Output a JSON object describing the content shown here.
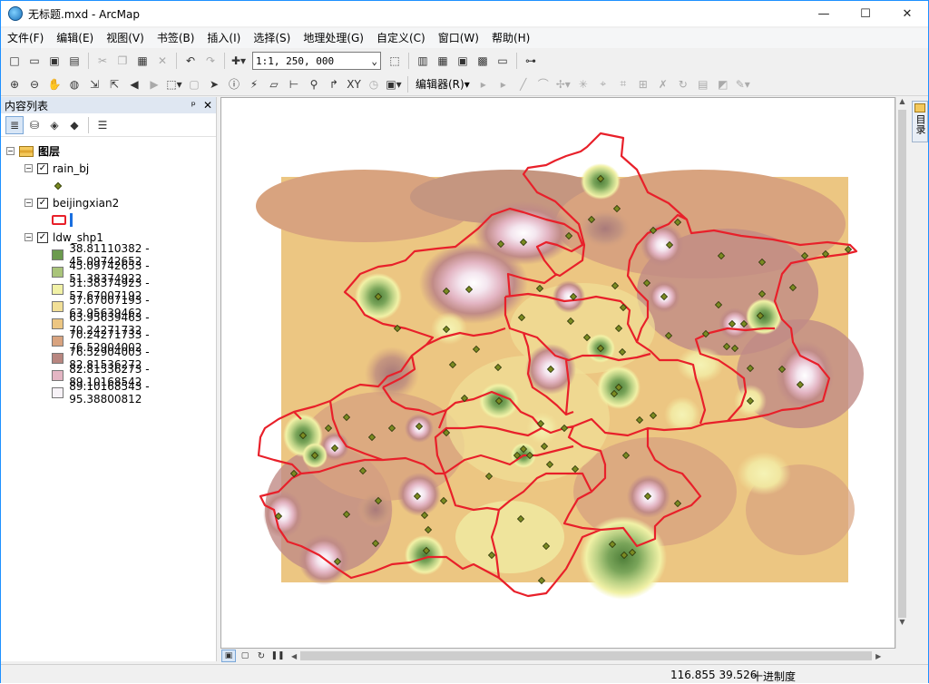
{
  "window": {
    "title": "无标题.mxd - ArcMap",
    "minimize": "—",
    "maximize": "☐",
    "close": "✕"
  },
  "menu": [
    "文件(F)",
    "编辑(E)",
    "视图(V)",
    "书签(B)",
    "插入(I)",
    "选择(S)",
    "地理处理(G)",
    "自定义(C)",
    "窗口(W)",
    "帮助(H)"
  ],
  "toolbar": {
    "scale": "1:1, 250, 000",
    "editor_label": "编辑器(R)▾"
  },
  "toc": {
    "title": "内容列表",
    "pin": "ᵖ",
    "close": "✕",
    "root_label": "图层",
    "layers": [
      {
        "name": "rain_bj",
        "checked": true
      },
      {
        "name": "beijingxian2",
        "checked": true
      },
      {
        "name": "ldw_shp1",
        "checked": true
      }
    ],
    "classes": [
      {
        "label": "38.81110382 - 45.09742652",
        "color": "#6b9a4e"
      },
      {
        "label": "45.09742653 - 51.38374922",
        "color": "#a9c47a"
      },
      {
        "label": "51.38374923 - 57.67007192",
        "color": "#f1f1a6"
      },
      {
        "label": "57.67007193 - 63.95639462",
        "color": "#f1df97"
      },
      {
        "label": "63.95639463 - 70.24271732",
        "color": "#ecc682"
      },
      {
        "label": "70.24271733 - 76.52904002",
        "color": "#d8a37f"
      },
      {
        "label": "76.52904003 - 82.81536272",
        "color": "#b88680"
      },
      {
        "label": "82.81536273 - 89.10168542",
        "color": "#e3b5c3"
      },
      {
        "label": "89.10168543 - 95.38800812",
        "color": "#f7f2f7"
      }
    ]
  },
  "side_tab": "目录",
  "status": {
    "coords": "116.855  39.526",
    "units": "十进制度"
  }
}
